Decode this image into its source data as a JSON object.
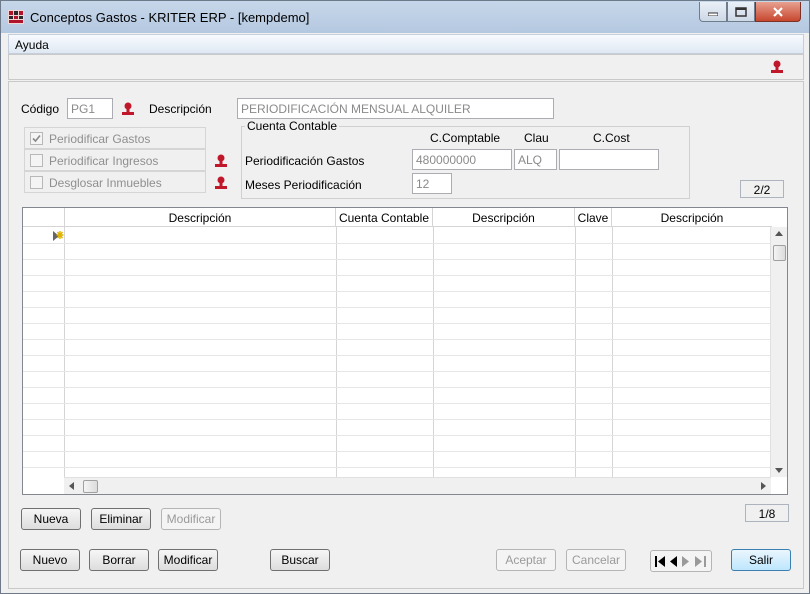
{
  "window": {
    "title": "Conceptos Gastos - KRITER ERP - [kempdemo]"
  },
  "menu": {
    "items": [
      "Ayuda"
    ]
  },
  "form": {
    "codigo_label": "Código",
    "codigo_value": "PG1",
    "descripcion_label": "Descripción",
    "descripcion_value": "PERIODIFICACIÓN MENSUAL ALQUILER",
    "checks": [
      {
        "label": "Periodificar Gastos",
        "checked": true
      },
      {
        "label": "Periodificar Ingresos",
        "checked": false
      },
      {
        "label": "Desglosar Inmuebles",
        "checked": false
      }
    ],
    "cuenta_contable": {
      "legend": "Cuenta Contable",
      "col_headers": [
        "C.Comptable",
        "Clau",
        "C.Cost"
      ],
      "periodificacion_gastos_label": "Periodificación Gastos",
      "periodificacion_gastos_values": [
        "480000000",
        "ALQ",
        ""
      ],
      "meses_label": "Meses Periodificación",
      "meses_value": "12"
    },
    "record_counter": "2/2"
  },
  "grid": {
    "columns": [
      "Descripción",
      "Cuenta Contable",
      "Descripción",
      "Clave",
      "Descripción"
    ],
    "row_counter": "1/8"
  },
  "buttons": {
    "nueva": "Nueva",
    "eliminar": "Eliminar",
    "modificar_line": "Modificar",
    "nuevo": "Nuevo",
    "borrar": "Borrar",
    "modificar": "Modificar",
    "buscar": "Buscar",
    "aceptar": "Aceptar",
    "cancelar": "Cancelar",
    "salir": "Salir"
  },
  "icons": [
    "app-icon",
    "help-icon",
    "minimize-icon",
    "restore-icon",
    "close-icon",
    "first-record-icon",
    "prev-record-icon",
    "next-record-icon",
    "last-record-icon"
  ],
  "colors": {
    "help_icon": "#c0182a",
    "primary_button": "#bee6fd"
  }
}
